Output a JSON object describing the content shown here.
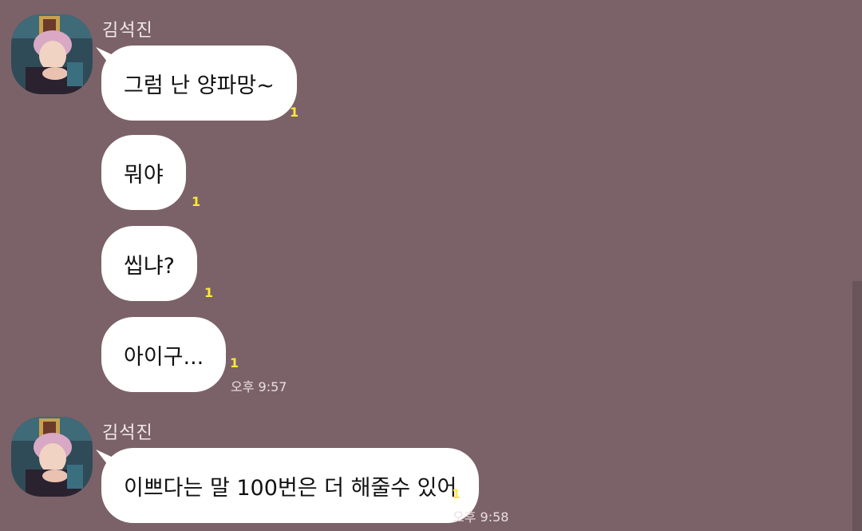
{
  "groups": [
    {
      "sender": "김석진",
      "messages": [
        {
          "text": "그럼 난 양파망~",
          "unread": "1"
        },
        {
          "text": "뭐야",
          "unread": "1"
        },
        {
          "text": "씹냐?",
          "unread": "1"
        },
        {
          "text": "아이구...",
          "unread": "1",
          "time": "오후 9:57"
        }
      ]
    },
    {
      "sender": "김석진",
      "messages": [
        {
          "text": "이쁘다는 말 100번은 더 해줄수 있어",
          "unread": "1",
          "time": "오후 9:58"
        }
      ]
    }
  ],
  "colors": {
    "background": "#7b6268",
    "bubble": "#ffffff",
    "unread": "#ffe83a"
  }
}
